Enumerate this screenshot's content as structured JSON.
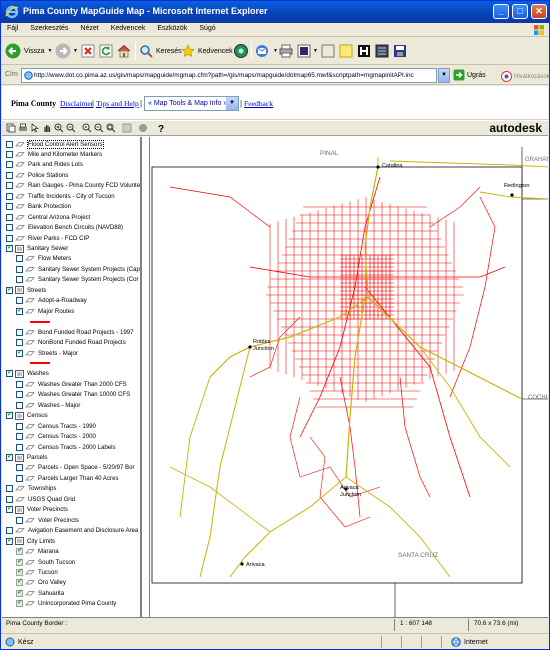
{
  "window": {
    "title": "Pima County MapGuide Map - Microsoft Internet Explorer"
  },
  "menu": [
    "Fájl",
    "Szerkesztés",
    "Nézet",
    "Kedvencek",
    "Eszközök",
    "Súgó"
  ],
  "toolbar": {
    "back_label": "Vissza",
    "search_label": "Keresés",
    "favorites_label": "Kedvencek"
  },
  "address": {
    "label": "Cím",
    "url": "http://www.dot.co.pima.az.us/gis/maps/mapguide/mgmap.cfm?path=/gis/maps/mapguide/dotmap65.mwf&scriptpath=mgmapinitAPI.inc",
    "go_label": "Ugrás",
    "links_label": "Hivatkozások"
  },
  "app": {
    "brand": "Pima County",
    "links": [
      "Disclaimer",
      "Tips and Help",
      "Feedback"
    ],
    "select_value": "« Map Tools & Map Info »",
    "logo": "autodesk"
  },
  "legend": [
    {
      "label": "Flood Control Alert Sensors",
      "level": 0,
      "checked": false,
      "kind": "layer",
      "selected": true
    },
    {
      "label": "Mile and Kilometer Markers",
      "level": 0,
      "checked": false,
      "kind": "layer"
    },
    {
      "label": "Park and Rides Lots",
      "level": 0,
      "checked": false,
      "kind": "layer"
    },
    {
      "label": "Police Stations",
      "level": 0,
      "checked": false,
      "kind": "layer"
    },
    {
      "label": "Rain Gauges - Pima County FCD Volunte",
      "level": 0,
      "checked": false,
      "kind": "layer"
    },
    {
      "label": "Traffic Incidents - City of Tucson",
      "level": 0,
      "checked": false,
      "kind": "layer"
    },
    {
      "label": "Bank Protection",
      "level": 0,
      "checked": false,
      "kind": "layer"
    },
    {
      "label": "Central Arizona Project",
      "level": 0,
      "checked": false,
      "kind": "layer"
    },
    {
      "label": "Elevation Bench Circuits (NAVD88)",
      "level": 0,
      "checked": false,
      "kind": "layer"
    },
    {
      "label": "River Parks - FCD CIP",
      "level": 0,
      "checked": false,
      "kind": "layer"
    },
    {
      "label": "Sanitary Sewer",
      "level": 0,
      "checked": true,
      "kind": "group"
    },
    {
      "label": "Flow Meters",
      "level": 1,
      "checked": false,
      "kind": "layer"
    },
    {
      "label": "Sanitary Sewer System Projects (Cap",
      "level": 1,
      "checked": false,
      "kind": "layer"
    },
    {
      "label": "Sanitary Sewer System Projects (Cor",
      "level": 1,
      "checked": false,
      "kind": "layer"
    },
    {
      "label": "Streets",
      "level": 0,
      "checked": true,
      "kind": "group"
    },
    {
      "label": "Adopt-a-Roadway",
      "level": 1,
      "checked": false,
      "kind": "layer"
    },
    {
      "label": "Major Routes",
      "level": 1,
      "checked": true,
      "kind": "layer"
    },
    {
      "label": "",
      "level": 1,
      "checked": false,
      "kind": "swatch"
    },
    {
      "label": "Bond Funded Road Projects - 1997",
      "level": 1,
      "checked": false,
      "kind": "layer"
    },
    {
      "label": "NonBond Funded Road Projects",
      "level": 1,
      "checked": false,
      "kind": "layer"
    },
    {
      "label": "Streets - Major",
      "level": 1,
      "checked": true,
      "kind": "layer"
    },
    {
      "label": "",
      "level": 1,
      "checked": false,
      "kind": "swatch"
    },
    {
      "label": "Washes",
      "level": 0,
      "checked": true,
      "kind": "group"
    },
    {
      "label": "Washes Greater Than 2000 CFS",
      "level": 1,
      "checked": false,
      "kind": "layer"
    },
    {
      "label": "Washes Greater Than 10000 CFS",
      "level": 1,
      "checked": false,
      "kind": "layer"
    },
    {
      "label": "Washes - Major",
      "level": 1,
      "checked": false,
      "kind": "layer"
    },
    {
      "label": "Census",
      "level": 0,
      "checked": true,
      "kind": "group"
    },
    {
      "label": "Census Tracts - 1990",
      "level": 1,
      "checked": false,
      "kind": "layer"
    },
    {
      "label": "Census Tracts - 2000",
      "level": 1,
      "checked": false,
      "kind": "layer"
    },
    {
      "label": "Census Tracts - 2000 Labels",
      "level": 1,
      "checked": false,
      "kind": "layer"
    },
    {
      "label": "Parcels",
      "level": 0,
      "checked": true,
      "kind": "group"
    },
    {
      "label": "Parcels - Open Space - 5/20/97 Bor",
      "level": 1,
      "checked": false,
      "kind": "layer"
    },
    {
      "label": "Parcels Larger Than 40 Acres",
      "level": 1,
      "checked": false,
      "kind": "layer"
    },
    {
      "label": "Townships",
      "level": 0,
      "checked": false,
      "kind": "layer"
    },
    {
      "label": "USGS Quad Grid",
      "level": 0,
      "checked": false,
      "kind": "layer"
    },
    {
      "label": "Voter Precincts",
      "level": 0,
      "checked": true,
      "kind": "group"
    },
    {
      "label": "Voter Precincts",
      "level": 1,
      "checked": false,
      "kind": "layer"
    },
    {
      "label": "Avigation Easement and Disclosure Area",
      "level": 0,
      "checked": false,
      "kind": "layer"
    },
    {
      "label": "City Limits",
      "level": 0,
      "checked": true,
      "kind": "group"
    },
    {
      "label": "Marana",
      "level": 1,
      "checked": true,
      "kind": "layer",
      "disabled": true
    },
    {
      "label": "South Tucson",
      "level": 1,
      "checked": true,
      "kind": "layer",
      "disabled": true
    },
    {
      "label": "Tucson",
      "level": 1,
      "checked": true,
      "kind": "layer",
      "disabled": true
    },
    {
      "label": "Oro Valley",
      "level": 1,
      "checked": true,
      "kind": "layer",
      "disabled": true
    },
    {
      "label": "Sahuarita",
      "level": 1,
      "checked": true,
      "kind": "layer",
      "disabled": true
    },
    {
      "label": "Unincorporated Pima County",
      "level": 1,
      "checked": true,
      "kind": "layer",
      "disabled": true
    }
  ],
  "map": {
    "county_labels": [
      "PINAL",
      "GRAHAM",
      "COCHISE",
      "SANTA CRUZ"
    ],
    "place_labels": [
      "Catalina",
      "Redington",
      "Robles Junction",
      "Arivaca Junction",
      "Arivaca"
    ],
    "street_color": "#ff0000",
    "highway_color": "#c8b400",
    "boundary_color": "#000000"
  },
  "map_status": {
    "layer_text": "Pima County Border :",
    "scale": "1 : 607 148",
    "size": "70.6 x 73.6 (mi)"
  },
  "ie_status": {
    "left": "Kész",
    "zone": "Internet"
  }
}
